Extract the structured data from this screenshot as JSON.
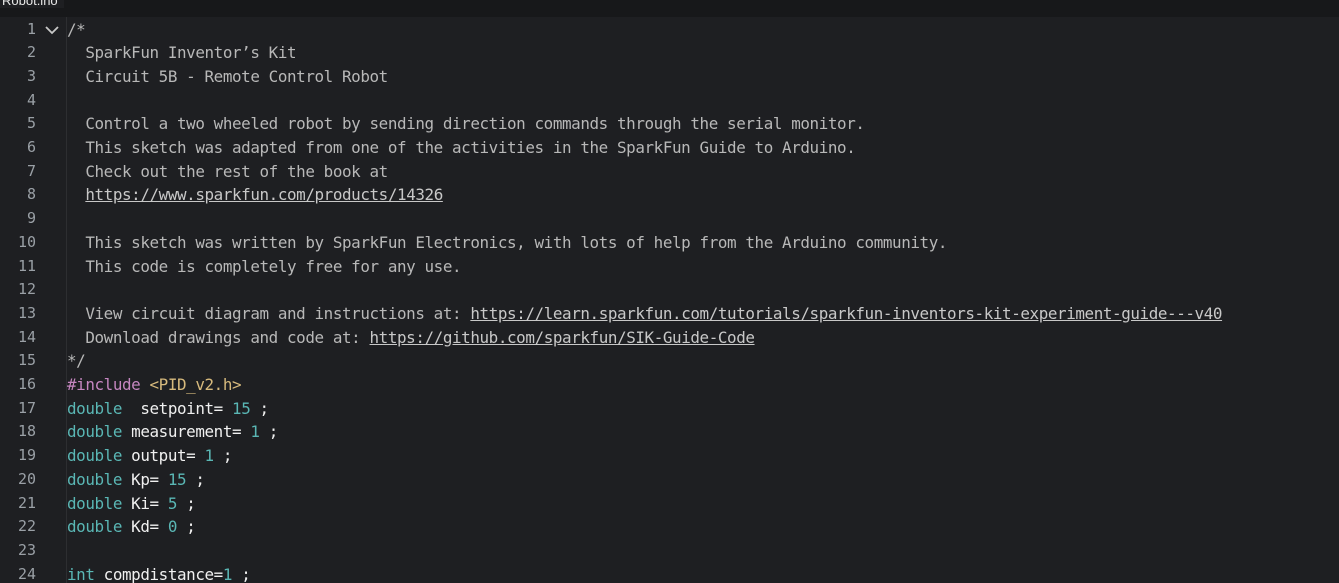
{
  "tab": {
    "title": "Robot.ino"
  },
  "editor": {
    "lines": [
      {
        "num": "1",
        "segments": [
          {
            "t": "/*",
            "c": "comment"
          }
        ],
        "fold": true
      },
      {
        "num": "2",
        "segments": [
          {
            "t": "  SparkFun Inventor’s Kit",
            "c": "comment"
          }
        ]
      },
      {
        "num": "3",
        "segments": [
          {
            "t": "  Circuit 5B - Remote Control Robot",
            "c": "comment"
          }
        ]
      },
      {
        "num": "4",
        "segments": []
      },
      {
        "num": "5",
        "segments": [
          {
            "t": "  Control a two wheeled robot by sending direction commands through the serial monitor.",
            "c": "comment"
          }
        ]
      },
      {
        "num": "6",
        "segments": [
          {
            "t": "  This sketch was adapted from one of the activities in the SparkFun Guide to Arduino.",
            "c": "comment"
          }
        ]
      },
      {
        "num": "7",
        "segments": [
          {
            "t": "  Check out the rest of the book at",
            "c": "comment"
          }
        ]
      },
      {
        "num": "8",
        "segments": [
          {
            "t": "  ",
            "c": "comment"
          },
          {
            "t": "https://www.sparkfun.com/products/14326",
            "c": "url"
          }
        ]
      },
      {
        "num": "9",
        "segments": []
      },
      {
        "num": "10",
        "segments": [
          {
            "t": "  This sketch was written by SparkFun Electronics, with lots of help from the Arduino community.",
            "c": "comment"
          }
        ]
      },
      {
        "num": "11",
        "segments": [
          {
            "t": "  This code is completely free for any use.",
            "c": "comment"
          }
        ]
      },
      {
        "num": "12",
        "segments": []
      },
      {
        "num": "13",
        "segments": [
          {
            "t": "  View circuit diagram and instructions at: ",
            "c": "comment"
          },
          {
            "t": "https://learn.sparkfun.com/tutorials/sparkfun-inventors-kit-experiment-guide---v40",
            "c": "url"
          }
        ]
      },
      {
        "num": "14",
        "segments": [
          {
            "t": "  Download drawings and code at: ",
            "c": "comment"
          },
          {
            "t": "https://github.com/sparkfun/SIK-Guide-Code",
            "c": "url"
          }
        ]
      },
      {
        "num": "15",
        "segments": [
          {
            "t": "*/",
            "c": "comment"
          }
        ]
      },
      {
        "num": "16",
        "segments": [
          {
            "t": "#include ",
            "c": "pp"
          },
          {
            "t": "<PID_v2.h>",
            "c": "str"
          }
        ]
      },
      {
        "num": "17",
        "segments": [
          {
            "t": "double",
            "c": "kw"
          },
          {
            "t": "  setpoint= ",
            "c": "plain"
          },
          {
            "t": "15",
            "c": "num"
          },
          {
            "t": " ;",
            "c": "plain"
          }
        ]
      },
      {
        "num": "18",
        "segments": [
          {
            "t": "double",
            "c": "kw"
          },
          {
            "t": " measurement= ",
            "c": "plain"
          },
          {
            "t": "1",
            "c": "num"
          },
          {
            "t": " ;",
            "c": "plain"
          }
        ]
      },
      {
        "num": "19",
        "segments": [
          {
            "t": "double",
            "c": "kw"
          },
          {
            "t": " output= ",
            "c": "plain"
          },
          {
            "t": "1",
            "c": "num"
          },
          {
            "t": " ;",
            "c": "plain"
          }
        ]
      },
      {
        "num": "20",
        "segments": [
          {
            "t": "double",
            "c": "kw"
          },
          {
            "t": " Kp= ",
            "c": "plain"
          },
          {
            "t": "15",
            "c": "num"
          },
          {
            "t": " ;",
            "c": "plain"
          }
        ]
      },
      {
        "num": "21",
        "segments": [
          {
            "t": "double",
            "c": "kw"
          },
          {
            "t": " Ki= ",
            "c": "plain"
          },
          {
            "t": "5",
            "c": "num"
          },
          {
            "t": " ;",
            "c": "plain"
          }
        ]
      },
      {
        "num": "22",
        "segments": [
          {
            "t": "double",
            "c": "kw"
          },
          {
            "t": " Kd= ",
            "c": "plain"
          },
          {
            "t": "0",
            "c": "num"
          },
          {
            "t": " ;",
            "c": "plain"
          }
        ]
      },
      {
        "num": "23",
        "segments": []
      },
      {
        "num": "24",
        "segments": [
          {
            "t": "int",
            "c": "kw"
          },
          {
            "t": " compdistance=",
            "c": "plain"
          },
          {
            "t": "1",
            "c": "num"
          },
          {
            "t": " ;",
            "c": "plain"
          }
        ]
      }
    ]
  },
  "icons": {
    "fold": "chevron-down-icon"
  },
  "colors": {
    "background": "#1e1f22",
    "comment": "#b8b8b8",
    "keyword": "#5ab7b5",
    "preprocessor": "#c586c0",
    "string": "#d7ba7d",
    "line_number": "#9aa0a6"
  }
}
